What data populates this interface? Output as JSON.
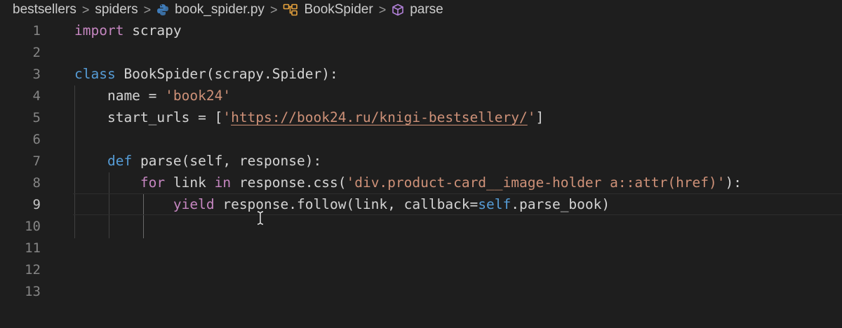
{
  "breadcrumb": {
    "items": [
      {
        "label": "bestsellers"
      },
      {
        "label": "spiders"
      },
      {
        "label": "book_spider.py"
      },
      {
        "label": "BookSpider"
      },
      {
        "label": "parse"
      }
    ],
    "separator": ">"
  },
  "editor": {
    "current_line": 9,
    "line_numbers": [
      "1",
      "2",
      "3",
      "4",
      "5",
      "6",
      "7",
      "8",
      "9",
      "10",
      "11",
      "12",
      "13"
    ],
    "tokens": {
      "l1_import": "import",
      "l1_module": " scrapy",
      "l3_class": "class",
      "l3_name": " BookSpider",
      "l3_rest": "(scrapy.Spider):",
      "l4_indent": "    name = ",
      "l4_value": "'book24'",
      "l5_indent": "    start_urls = [",
      "l5_q1": "'",
      "l5_url": "https://book24.ru/knigi-bestsellery/",
      "l5_q2": "'",
      "l5_end": "]",
      "l7_indent": "    ",
      "l7_def": "def",
      "l7_rest": " parse(self, response):",
      "l8_indent": "        ",
      "l8_for": "for",
      "l8_mid": " link ",
      "l8_in": "in",
      "l8_call": " response.css(",
      "l8_str": "'div.product-card__image-holder a::attr(href)'",
      "l8_end": "):",
      "l9_indent": "            ",
      "l9_yield": "yield",
      "l9_call": " response.follow(link, callback=",
      "l9_self": "self",
      "l9_end": ".parse_book)"
    }
  },
  "colors": {
    "background": "#1e1e1e",
    "keyword": "#569cd6",
    "control_keyword": "#c586c0",
    "string": "#ce9178",
    "line_number": "#858585"
  },
  "icons": [
    "chevron-right-icon",
    "python-file-icon",
    "class-icon",
    "method-icon",
    "text-cursor-icon"
  ]
}
